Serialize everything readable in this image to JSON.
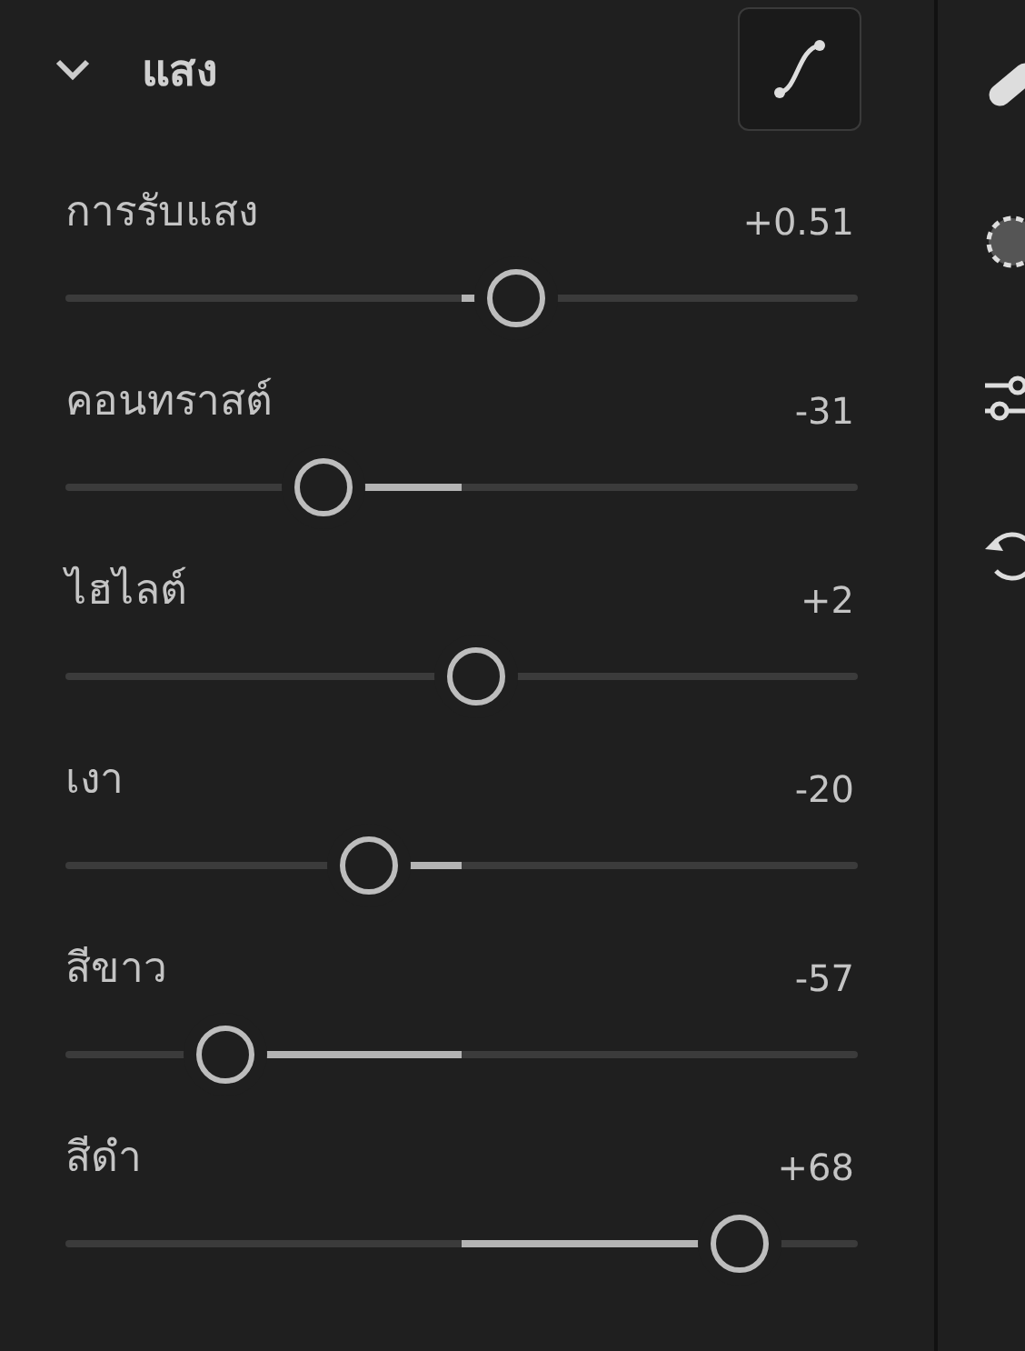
{
  "section": {
    "title": "แสง",
    "expanded": true
  },
  "sliders": [
    {
      "label": "การรับแสง",
      "reading": "+0.51",
      "level": 0.569
    },
    {
      "label": "คอนทราสต์",
      "reading": "-31",
      "level": 0.326
    },
    {
      "label": "ไฮไลต์",
      "reading": "+2",
      "level": 0.518
    },
    {
      "label": "เงา",
      "reading": "-20",
      "level": 0.383
    },
    {
      "label": "สีขาว",
      "reading": "-57",
      "level": 0.202
    },
    {
      "label": "สีดำ",
      "reading": "+68",
      "level": 0.851
    }
  ],
  "tools": [
    {
      "kind": "brush"
    },
    {
      "kind": "mask"
    },
    {
      "kind": "adjust"
    },
    {
      "kind": "history"
    }
  ]
}
